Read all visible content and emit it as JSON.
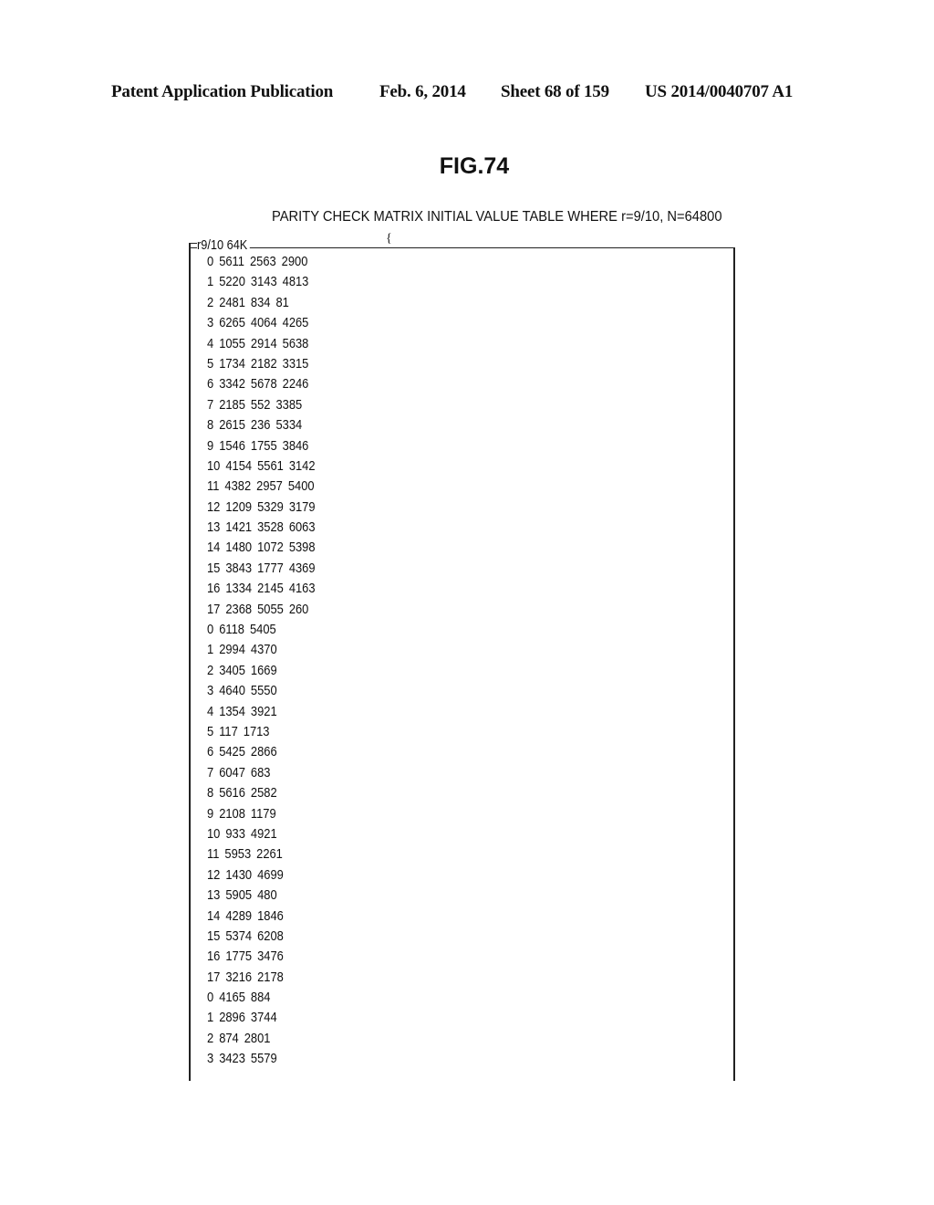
{
  "header": {
    "publication": "Patent Application Publication",
    "date": "Feb. 6, 2014",
    "sheet": "Sheet 68 of 159",
    "patent_number": "US 2014/0040707 A1"
  },
  "figure": {
    "label": "FIG.74",
    "caption": "PARITY CHECK MATRIX INITIAL VALUE TABLE WHERE r=9/10, N=64800",
    "table_title": "r9/10 64K",
    "rows": [
      [
        "0",
        "5611",
        "2563",
        "2900"
      ],
      [
        "1",
        "5220",
        "3143",
        "4813"
      ],
      [
        "2",
        "2481",
        "834",
        "81"
      ],
      [
        "3",
        "6265",
        "4064",
        "4265"
      ],
      [
        "4",
        "1055",
        "2914",
        "5638"
      ],
      [
        "5",
        "1734",
        "2182",
        "3315"
      ],
      [
        "6",
        "3342",
        "5678",
        "2246"
      ],
      [
        "7",
        "2185",
        "552",
        "3385"
      ],
      [
        "8",
        "2615",
        "236",
        "5334"
      ],
      [
        "9",
        "1546",
        "1755",
        "3846"
      ],
      [
        "10",
        "4154",
        "5561",
        "3142"
      ],
      [
        "11",
        "4382",
        "2957",
        "5400"
      ],
      [
        "12",
        "1209",
        "5329",
        "3179"
      ],
      [
        "13",
        "1421",
        "3528",
        "6063"
      ],
      [
        "14",
        "1480",
        "1072",
        "5398"
      ],
      [
        "15",
        "3843",
        "1777",
        "4369"
      ],
      [
        "16",
        "1334",
        "2145",
        "4163"
      ],
      [
        "17",
        "2368",
        "5055",
        "260"
      ],
      [
        "0",
        "6118",
        "5405"
      ],
      [
        "1",
        "2994",
        "4370"
      ],
      [
        "2",
        "3405",
        "1669"
      ],
      [
        "3",
        "4640",
        "5550"
      ],
      [
        "4",
        "1354",
        "3921"
      ],
      [
        "5",
        "117",
        "1713"
      ],
      [
        "6",
        "5425",
        "2866"
      ],
      [
        "7",
        "6047",
        "683"
      ],
      [
        "8",
        "5616",
        "2582"
      ],
      [
        "9",
        "2108",
        "1179"
      ],
      [
        "10",
        "933",
        "4921"
      ],
      [
        "11",
        "5953",
        "2261"
      ],
      [
        "12",
        "1430",
        "4699"
      ],
      [
        "13",
        "5905",
        "480"
      ],
      [
        "14",
        "4289",
        "1846"
      ],
      [
        "15",
        "5374",
        "6208"
      ],
      [
        "16",
        "1775",
        "3476"
      ],
      [
        "17",
        "3216",
        "2178"
      ],
      [
        "0",
        "4165",
        "884"
      ],
      [
        "1",
        "2896",
        "3744"
      ],
      [
        "2",
        "874",
        "2801"
      ],
      [
        "3",
        "3423",
        "5579"
      ]
    ]
  }
}
